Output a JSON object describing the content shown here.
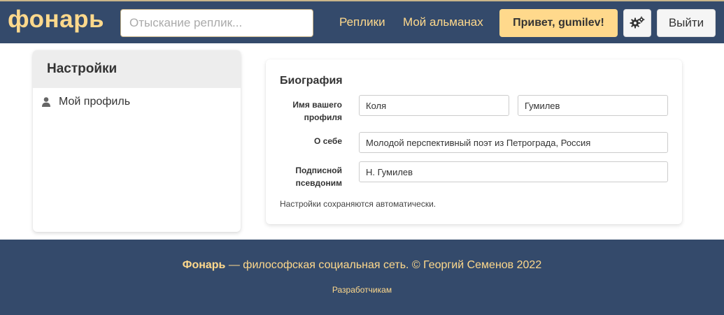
{
  "header": {
    "logo": "фонарь",
    "search_placeholder": "Отыскание реплик...",
    "nav": {
      "replies": "Реплики",
      "almanac": "Мой альманах"
    },
    "greeting": "Привет, gumilev!",
    "settings_icon": "gears-icon",
    "logout": "Выйти"
  },
  "sidebar": {
    "title": "Настройки",
    "items": [
      {
        "label": "Мой профиль",
        "icon": "user-icon"
      }
    ]
  },
  "biography": {
    "title": "Биография",
    "fields": {
      "name_label": "Имя вашего профиля",
      "first_name": "Коля",
      "last_name": "Гумилев",
      "about_label": "О себе",
      "about": "Молодой перспективный поэт из Петрограда, Россия",
      "signature_label": "Подписной псевдоним",
      "signature": "Н. Гумилев"
    },
    "note": "Настройки сохраняются автоматически."
  },
  "footer": {
    "brand": "Фонарь",
    "tagline": " — философская социальная сеть. © Георгий Семенов 2022",
    "developers": "Разработчикам"
  },
  "colors": {
    "navy": "#344a6b",
    "accent": "#ffd98c"
  }
}
